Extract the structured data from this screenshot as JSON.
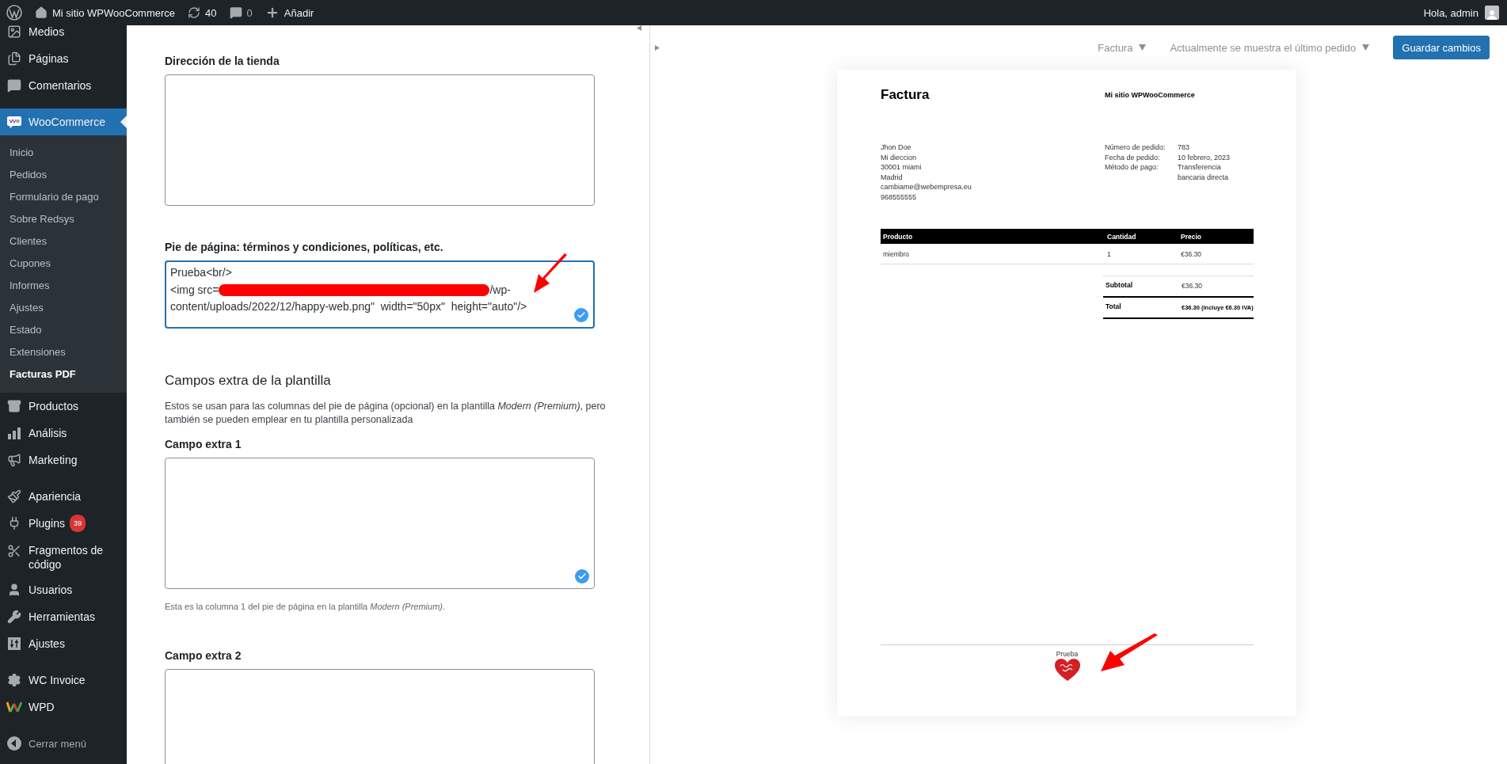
{
  "admin_bar": {
    "site_name": "Mi sitio WPWooCommerce",
    "updates": "40",
    "comments": "0",
    "new_label": "Añadir",
    "greeting": "Hola, admin"
  },
  "sidebar": {
    "groups": [
      {
        "items": [
          {
            "label": "Medios",
            "selected": false
          },
          {
            "label": "Páginas",
            "selected": false
          },
          {
            "label": "Comentarios",
            "selected": false
          }
        ]
      },
      {
        "items": [
          {
            "label": "WooCommerce",
            "selected": true,
            "children": [
              {
                "label": "Inicio",
                "selected": false
              },
              {
                "label": "Pedidos",
                "selected": false
              },
              {
                "label": "Formulario de pago",
                "selected": false
              },
              {
                "label": "Sobre Redsys",
                "selected": false
              },
              {
                "label": "Clientes",
                "selected": false
              },
              {
                "label": "Cupones",
                "selected": false
              },
              {
                "label": "Informes",
                "selected": false
              },
              {
                "label": "Ajustes",
                "selected": false
              },
              {
                "label": "Estado",
                "selected": false
              },
              {
                "label": "Extensiones",
                "selected": false
              },
              {
                "label": "Facturas PDF",
                "selected": true
              }
            ]
          },
          {
            "label": "Productos",
            "selected": false
          },
          {
            "label": "Análisis",
            "selected": false
          },
          {
            "label": "Marketing",
            "selected": false
          }
        ]
      },
      {
        "items": [
          {
            "label": "Apariencia",
            "selected": false
          },
          {
            "label": "Plugins",
            "selected": false,
            "badge": "39"
          },
          {
            "label": "Fragmentos de código",
            "selected": false
          },
          {
            "label": "Usuarios",
            "selected": false
          },
          {
            "label": "Herramientas",
            "selected": false
          },
          {
            "label": "Ajustes",
            "selected": false
          }
        ]
      },
      {
        "items": [
          {
            "label": "WC Invoice",
            "selected": false
          },
          {
            "label": "WPD",
            "selected": false
          }
        ]
      }
    ],
    "collapse_label": "Cerrar menú"
  },
  "settings": {
    "items": [
      {
        "kind": "field",
        "label": "Dirección de la tienda",
        "focused": false,
        "check_badge": false
      },
      {
        "kind": "field",
        "label": "Pie de página: términos y condiciones, políticas, etc.",
        "value_before_redaction": "Prueba<br/>\n<img src=",
        "value_after_redaction": "/wp-\ncontent/uploads/2022/12/happy-web.png\"  width=\"50px\"  height=\"auto\"/>",
        "focused": true,
        "check_badge": true
      },
      {
        "kind": "heading",
        "text": "Campos extra de la plantilla"
      },
      {
        "kind": "description",
        "text": "Estos se usan para las columnas del pie de página (opcional) en la plantilla *Modern (Premium)*, pero también se pueden emplear en tu plantilla personalizada"
      },
      {
        "kind": "field",
        "label": "Campo extra 1",
        "focused": false,
        "check_badge": true,
        "hint": "Esta es la columna 1 del pie de página en la plantilla *Modern (Premium)*."
      },
      {
        "kind": "field",
        "label": "Campo extra 2",
        "focused": false,
        "check_badge": false
      }
    ]
  },
  "preview": {
    "document_select": "Factura",
    "order_select": "Actualmente se muestra el último pedido",
    "save_button": "Guardar cambios",
    "invoice": {
      "title": "Factura",
      "shop_name": "Mi sitio WPWooCommerce",
      "billing_address": [
        "Jhon Doe",
        "Mi dieccion",
        "30001 miami",
        "Madrid",
        "cambiame@webempresa.eu",
        "968555555"
      ],
      "order_data": [
        {
          "label": "Número de pedido:",
          "value": "783"
        },
        {
          "label": "Fecha de pedido:",
          "value": "10 febrero, 2023"
        },
        {
          "label": "Método de pago:",
          "value": "Transferencia bancaria directa"
        }
      ],
      "columns": [
        "Producto",
        "Cantidad",
        "Precio"
      ],
      "rows": [
        [
          "miembro",
          "1",
          "€36.30"
        ]
      ],
      "totals": [
        {
          "kind": "subtotal",
          "label": "Subtotal",
          "value": "€36.30"
        },
        {
          "kind": "total",
          "label": "Total",
          "value": "€36.30 (incluye €6.30 IVA)"
        }
      ],
      "footer": "Prueba"
    }
  }
}
